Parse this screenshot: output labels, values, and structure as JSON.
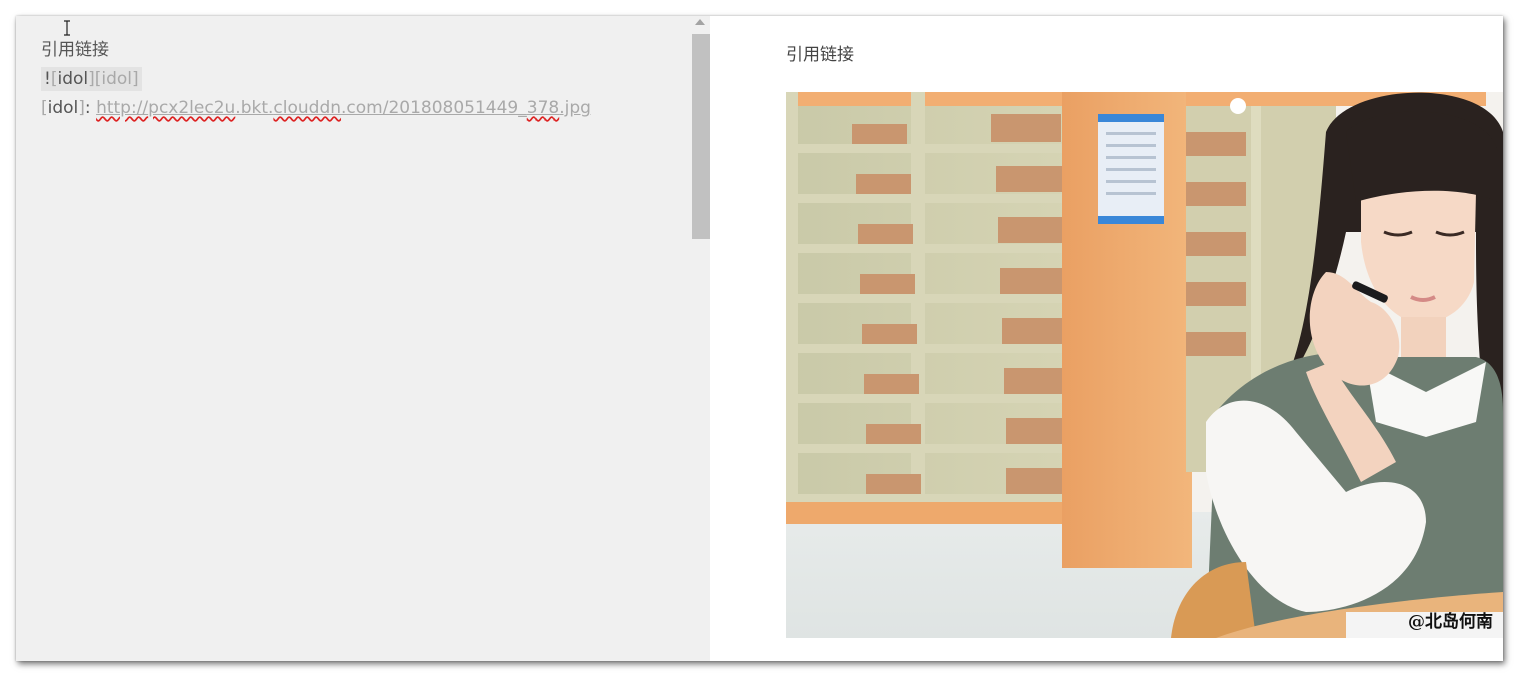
{
  "editor": {
    "heading": "引用链接",
    "image_ref": {
      "bang": "!",
      "bracket_open": "[",
      "alt": "idol",
      "bracket_mid": "][",
      "ref": "idol",
      "bracket_close": "]"
    },
    "link_def": {
      "bracket_open": "[",
      "label": "idol",
      "bracket_close": "]",
      "colon": ": ",
      "url_part1": "http://",
      "url_part2": "pcx2lec2u",
      "url_part3": ".bkt.",
      "url_part4": "clouddn",
      "url_part5": ".com/201808051449_",
      "url_part6": "378",
      "url_part7": ".jpg"
    }
  },
  "preview": {
    "heading": "引用链接",
    "watermark": "@北岛何南"
  },
  "colors": {
    "editor_bg": "#f0f0f0",
    "text": "#555555",
    "muted": "#a9a9a9",
    "spellcheck": "#dd2222"
  },
  "icons": {
    "cursor": "text-cursor-icon",
    "scroll_up": "scroll-up-arrow-icon",
    "divider": "chevron-right-icon"
  }
}
